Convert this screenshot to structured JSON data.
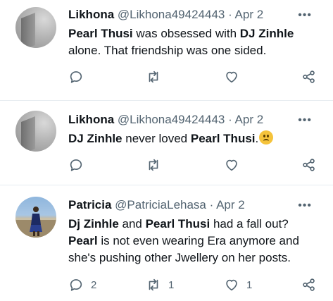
{
  "tweets": [
    {
      "name": "Likhona",
      "handle": "@Likhona49424443",
      "date": "· Apr 2",
      "more": "•••",
      "line1": [
        {
          "t": "Pearl Thusi",
          "b": true
        },
        {
          "t": " was obsessed with ",
          "b": false
        },
        {
          "t": "DJ Zinhle",
          "b": true
        }
      ],
      "line2": "alone. That friendship was one sided.",
      "reply_count": "",
      "retweet_count": "",
      "like_count": ""
    },
    {
      "name": "Likhona",
      "handle": "@Likhona49424443",
      "date": "· Apr 2",
      "more": "•••",
      "line1": [
        {
          "t": "DJ Zinhle",
          "b": true
        },
        {
          "t": " never loved ",
          "b": false
        },
        {
          "t": "Pearl Thusi",
          "b": true
        },
        {
          "t": ".",
          "b": false
        }
      ],
      "emoji": "confused-face",
      "reply_count": "",
      "retweet_count": "",
      "like_count": ""
    },
    {
      "name": "Patricia",
      "handle": "@PatriciaLehasa",
      "date": "· Apr 2",
      "more": "•••",
      "line1": [
        {
          "t": "Dj Zinhle",
          "b": true
        },
        {
          "t": " and ",
          "b": false
        },
        {
          "t": "Pearl Thusi",
          "b": true
        },
        {
          "t": " had a fall out?",
          "b": false
        }
      ],
      "line2_bold": "Pearl",
      "line2": " is not even wearing Era anymore and",
      "line3": "she's pushing other Jwellery on her posts.",
      "reply_count": "2",
      "retweet_count": "1",
      "like_count": "1"
    }
  ],
  "icons": [
    "reply-icon",
    "retweet-icon",
    "like-icon",
    "share-icon"
  ],
  "colors": {
    "text": "#0f1419",
    "meta": "#536471",
    "divider": "#e6ecf0"
  }
}
